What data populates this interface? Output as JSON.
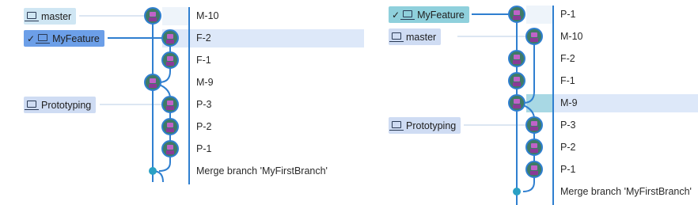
{
  "left_panel": {
    "branches": [
      {
        "label": "master",
        "head": false
      },
      {
        "label": "MyFeature",
        "head": true
      },
      {
        "label": "Prototyping",
        "head": false
      }
    ],
    "commits": [
      "M-10",
      "F-2",
      "F-1",
      "M-9",
      "P-3",
      "P-2",
      "P-1",
      "Merge branch 'MyFirstBranch'"
    ]
  },
  "right_panel": {
    "branches": [
      {
        "label": "MyFeature",
        "head": true
      },
      {
        "label": "master",
        "head": false
      },
      {
        "label": "Prototyping",
        "head": false
      }
    ],
    "commits": [
      "P-1",
      "M-10",
      "F-2",
      "F-1",
      "M-9",
      "P-3",
      "P-2",
      "P-1",
      "Merge branch 'MyFirstBranch'"
    ]
  },
  "icons": {
    "check": "✓",
    "branch_icon": "laptop-icon",
    "avatar": "avatar-icon"
  },
  "colors": {
    "graph_line": "#2f7fd0",
    "merge_node": "#2aa0c4",
    "selected_row": "#dde8f9"
  }
}
